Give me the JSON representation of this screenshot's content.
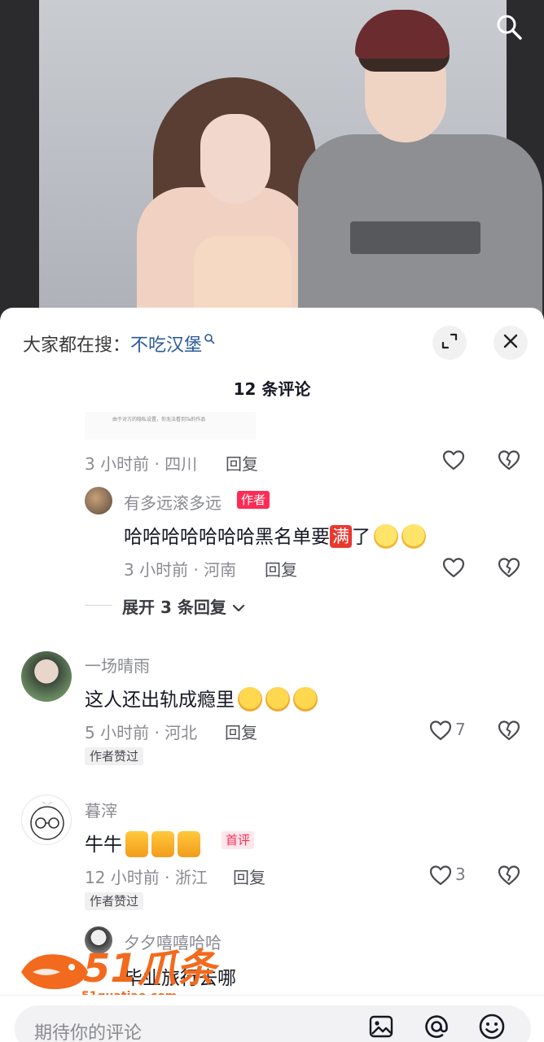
{
  "header": {
    "hot_search_prefix": "大家都在搜：",
    "hot_search_keyword": "不吃汉堡",
    "comment_count": "12 条评论"
  },
  "hidden_comment_note": "由于对方的隐私设置，你无法看到Ta的作品",
  "comments": [
    {
      "time_location": "3 小时前 · 四川",
      "reply_label": "回复"
    },
    {
      "username": "有多远滚多远",
      "badge": "作者",
      "text_before": "哈哈哈哈哈哈哈黑名单要",
      "box_char": "满",
      "text_after": "了",
      "time_location": "3 小时前 · 河南",
      "reply_label": "回复",
      "expand_label": "展开 3 条回复"
    },
    {
      "username": "一场晴雨",
      "text": "这人还出轨成瘾里",
      "time_location": "5 小时前 · 河北",
      "reply_label": "回复",
      "like_count": "7",
      "badge": "作者赞过"
    },
    {
      "username": "暮滓",
      "text": "牛牛",
      "first_badge": "首评",
      "time_location": "12 小时前 · 浙江",
      "reply_label": "回复",
      "like_count": "3",
      "badge": "作者赞过"
    },
    {
      "username": "夕夕嘻嘻哈哈",
      "text": "毕业旅行去哪"
    }
  ],
  "watermark": {
    "main": "51爪条",
    "sub": "51guatiao.com"
  },
  "input": {
    "placeholder": "期待你的评论"
  },
  "colors": {
    "accent_red": "#fe2c55",
    "link_blue": "#2a5a9c",
    "watermark_orange": "#f26a1d"
  }
}
